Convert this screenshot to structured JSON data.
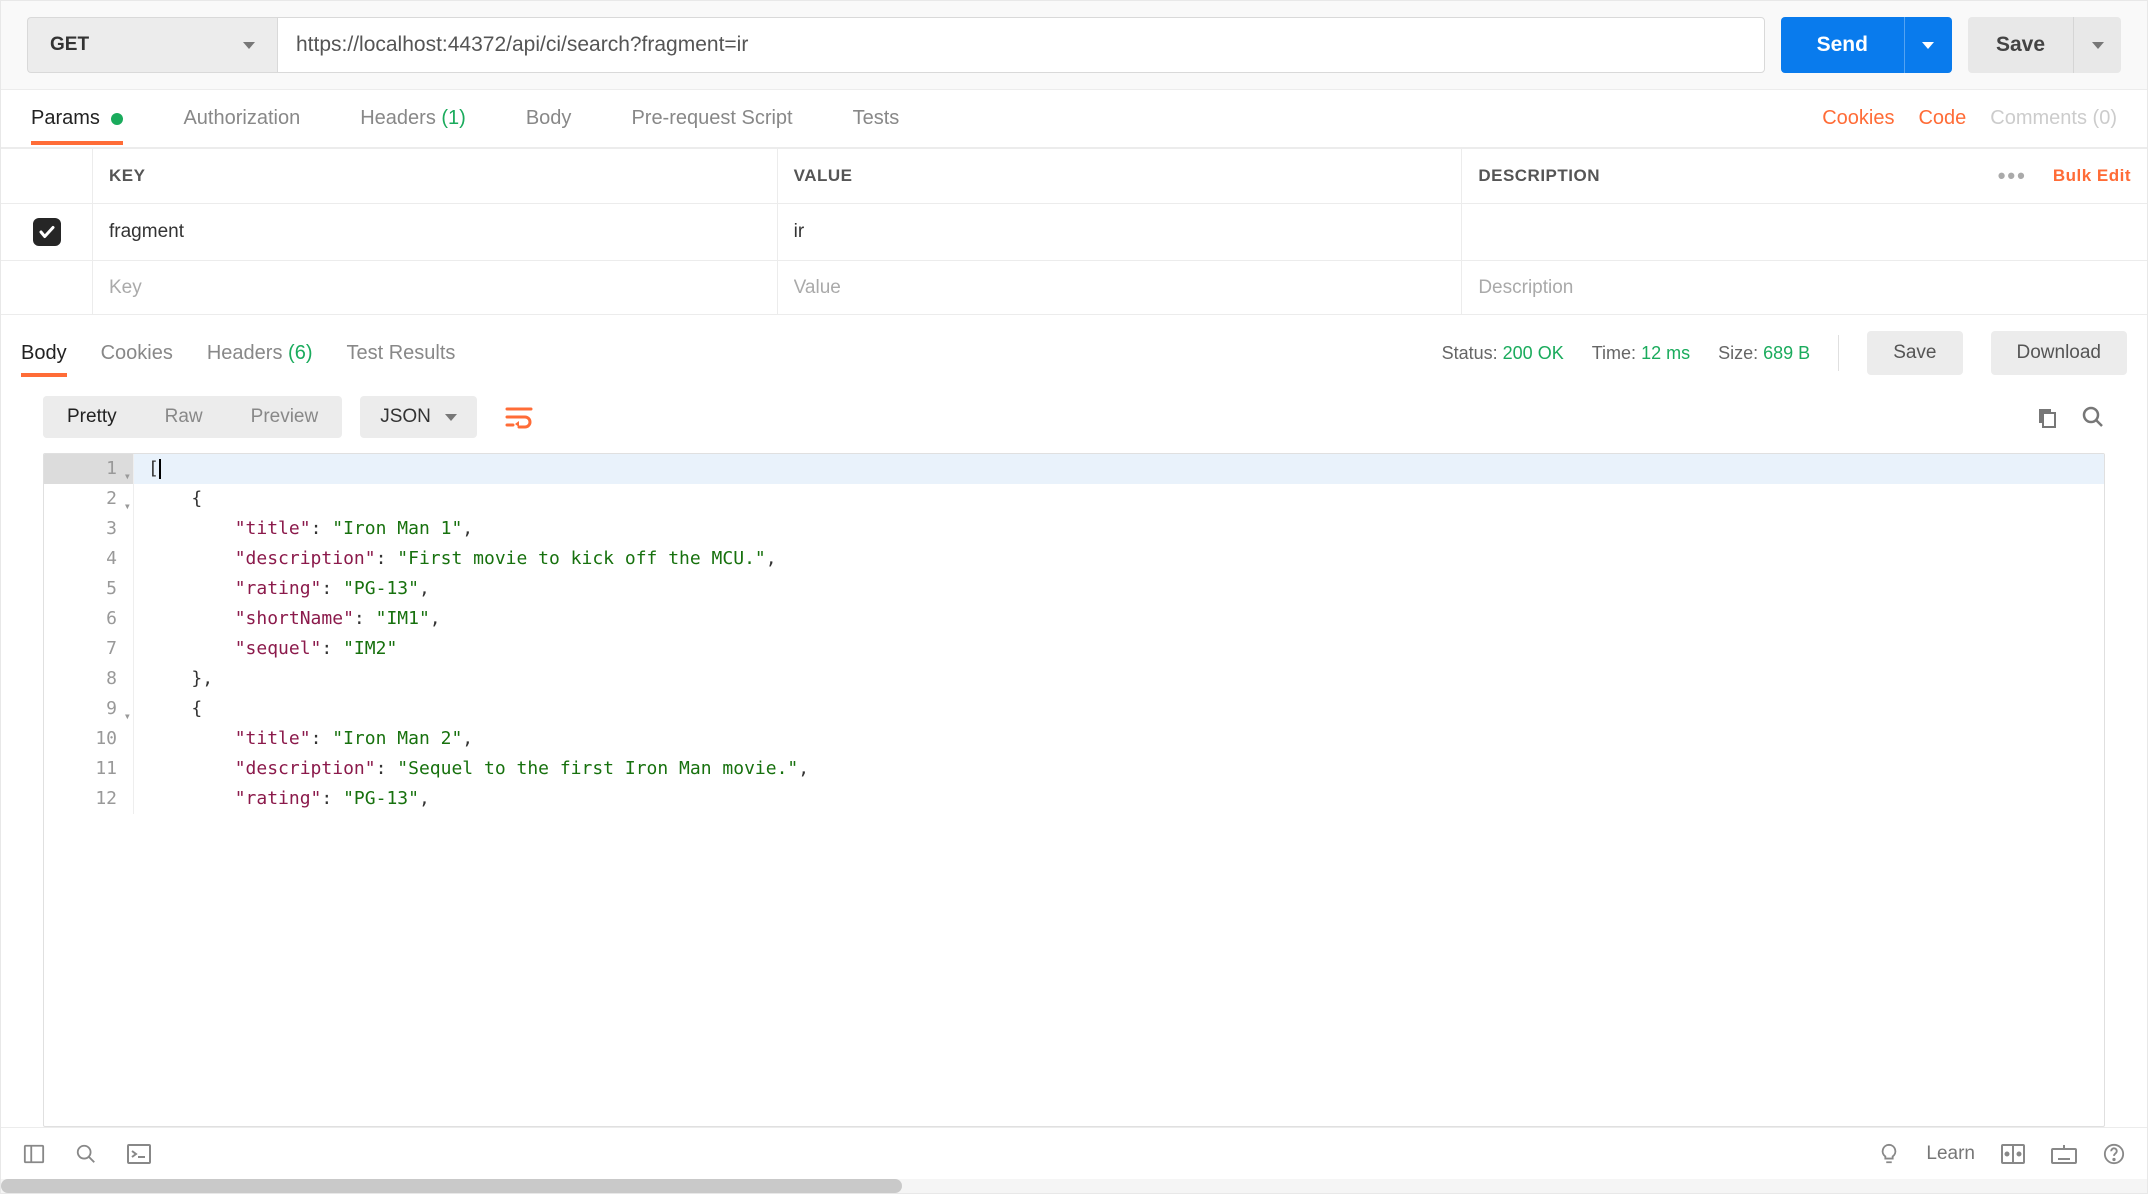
{
  "request": {
    "method": "GET",
    "url": "https://localhost:44372/api/ci/search?fragment=ir",
    "send_label": "Send",
    "save_label": "Save"
  },
  "req_tabs": {
    "params": "Params",
    "auth": "Authorization",
    "headers": "Headers",
    "headers_count": "(1)",
    "body": "Body",
    "prereq": "Pre-request Script",
    "tests": "Tests"
  },
  "req_links": {
    "cookies": "Cookies",
    "code": "Code",
    "comments": "Comments (0)"
  },
  "params_headers": {
    "key": "KEY",
    "value": "VALUE",
    "desc": "DESCRIPTION",
    "bulk": "Bulk Edit"
  },
  "params_rows": [
    {
      "checked": true,
      "key": "fragment",
      "value": "ir",
      "desc": ""
    }
  ],
  "params_placeholders": {
    "key": "Key",
    "value": "Value",
    "desc": "Description"
  },
  "resp_tabs": {
    "body": "Body",
    "cookies": "Cookies",
    "headers": "Headers",
    "headers_count": "(6)",
    "test_results": "Test Results"
  },
  "resp_meta": {
    "status_label": "Status:",
    "status_value": "200 OK",
    "time_label": "Time:",
    "time_value": "12 ms",
    "size_label": "Size:",
    "size_value": "689 B",
    "save": "Save",
    "download": "Download"
  },
  "format": {
    "pretty": "Pretty",
    "raw": "Raw",
    "preview": "Preview",
    "lang": "JSON"
  },
  "code_lines": [
    {
      "n": "1",
      "fold": true,
      "hl": true,
      "tokens": [
        [
          "punc",
          "["
        ],
        [
          "cursor",
          ""
        ]
      ]
    },
    {
      "n": "2",
      "fold": true,
      "tokens": [
        [
          "ind",
          1
        ],
        [
          "punc",
          "{"
        ]
      ]
    },
    {
      "n": "3",
      "tokens": [
        [
          "ind",
          2
        ],
        [
          "key",
          "\"title\""
        ],
        [
          "punc",
          ": "
        ],
        [
          "str",
          "\"Iron Man 1\""
        ],
        [
          "punc",
          ","
        ]
      ]
    },
    {
      "n": "4",
      "tokens": [
        [
          "ind",
          2
        ],
        [
          "key",
          "\"description\""
        ],
        [
          "punc",
          ": "
        ],
        [
          "str",
          "\"First movie to kick off the MCU.\""
        ],
        [
          "punc",
          ","
        ]
      ]
    },
    {
      "n": "5",
      "tokens": [
        [
          "ind",
          2
        ],
        [
          "key",
          "\"rating\""
        ],
        [
          "punc",
          ": "
        ],
        [
          "str",
          "\"PG-13\""
        ],
        [
          "punc",
          ","
        ]
      ]
    },
    {
      "n": "6",
      "tokens": [
        [
          "ind",
          2
        ],
        [
          "key",
          "\"shortName\""
        ],
        [
          "punc",
          ": "
        ],
        [
          "str",
          "\"IM1\""
        ],
        [
          "punc",
          ","
        ]
      ]
    },
    {
      "n": "7",
      "tokens": [
        [
          "ind",
          2
        ],
        [
          "key",
          "\"sequel\""
        ],
        [
          "punc",
          ": "
        ],
        [
          "str",
          "\"IM2\""
        ]
      ]
    },
    {
      "n": "8",
      "tokens": [
        [
          "ind",
          1
        ],
        [
          "punc",
          "},"
        ]
      ]
    },
    {
      "n": "9",
      "fold": true,
      "tokens": [
        [
          "ind",
          1
        ],
        [
          "punc",
          "{"
        ]
      ]
    },
    {
      "n": "10",
      "tokens": [
        [
          "ind",
          2
        ],
        [
          "key",
          "\"title\""
        ],
        [
          "punc",
          ": "
        ],
        [
          "str",
          "\"Iron Man 2\""
        ],
        [
          "punc",
          ","
        ]
      ]
    },
    {
      "n": "11",
      "tokens": [
        [
          "ind",
          2
        ],
        [
          "key",
          "\"description\""
        ],
        [
          "punc",
          ": "
        ],
        [
          "str",
          "\"Sequel to the first Iron Man movie.\""
        ],
        [
          "punc",
          ","
        ]
      ]
    },
    {
      "n": "12",
      "tokens": [
        [
          "ind",
          2
        ],
        [
          "key",
          "\"rating\""
        ],
        [
          "punc",
          ": "
        ],
        [
          "str",
          "\"PG-13\""
        ],
        [
          "punc",
          ","
        ]
      ]
    }
  ],
  "statusbar": {
    "learn": "Learn"
  }
}
